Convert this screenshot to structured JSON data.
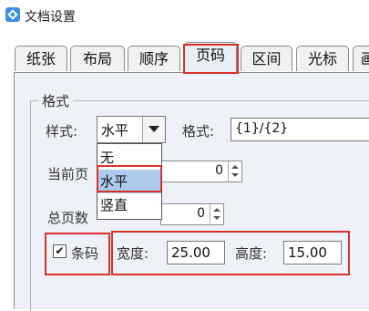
{
  "window": {
    "title": "文档设置"
  },
  "tabs": [
    "纸张",
    "布局",
    "顺序",
    "页码",
    "区间",
    "光标",
    "画"
  ],
  "active_tab": "页码",
  "group": {
    "legend": "格式"
  },
  "style": {
    "label": "样式:",
    "value": "水平"
  },
  "format": {
    "label": "格式:",
    "value": "{1}/{2}"
  },
  "current_page": {
    "label": "当前页",
    "value": "0"
  },
  "total_pages": {
    "label": "总页数",
    "value": "0"
  },
  "dropdown": {
    "options": [
      "无",
      "水平",
      "竖直"
    ],
    "selected": "水平"
  },
  "barcode": {
    "label": "条码",
    "checked": true,
    "check_glyph": "✔"
  },
  "width": {
    "label": "宽度:",
    "value": "25.00"
  },
  "height": {
    "label": "高度:",
    "value": "15.00"
  },
  "colors": {
    "highlight": "#d9312c",
    "selection": "#aecbeb",
    "panel": "#eef1f7"
  }
}
